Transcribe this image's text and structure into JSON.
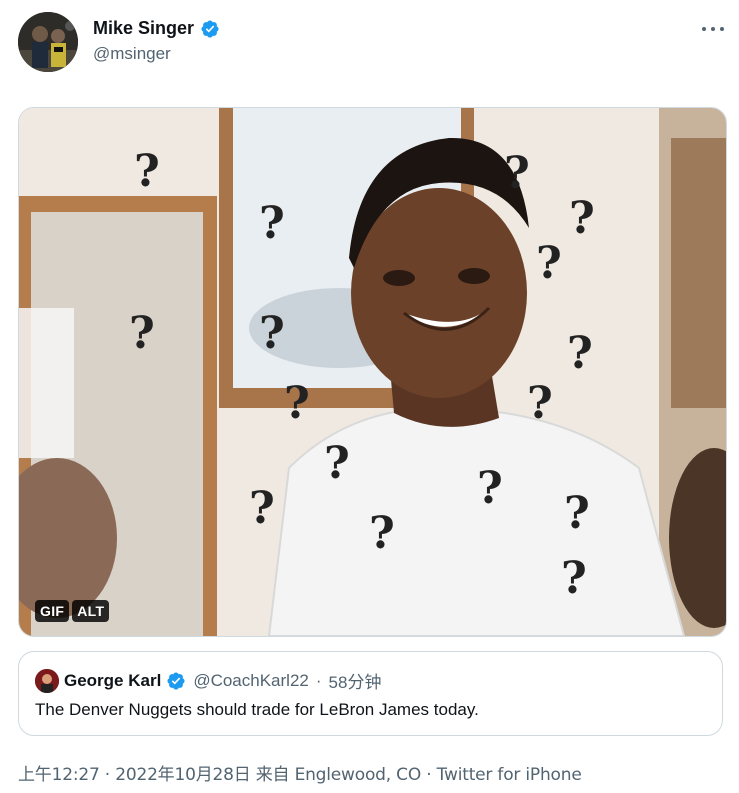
{
  "author": {
    "name": "Mike Singer",
    "handle": "@msinger",
    "verified": true
  },
  "media": {
    "badges": [
      "GIF",
      "ALT"
    ]
  },
  "quoted_tweet": {
    "name": "George Karl",
    "handle": "@CoachKarl22",
    "separator": "·",
    "time": "58分钟",
    "text": "The Denver Nuggets should trade for LeBron James today."
  },
  "meta": {
    "time": "上午12:27",
    "sep1": " · ",
    "date": "2022年10月28日",
    "from_label": " 来自 ",
    "location": "Englewood, CO",
    "sep2": " · ",
    "source": "Twitter for iPhone"
  },
  "colors": {
    "verified_blue": "#1d9bf0",
    "secondary_text": "#536471",
    "border": "#cfd9de"
  },
  "icons": [
    "verified-badge-icon",
    "more-options-icon"
  ]
}
